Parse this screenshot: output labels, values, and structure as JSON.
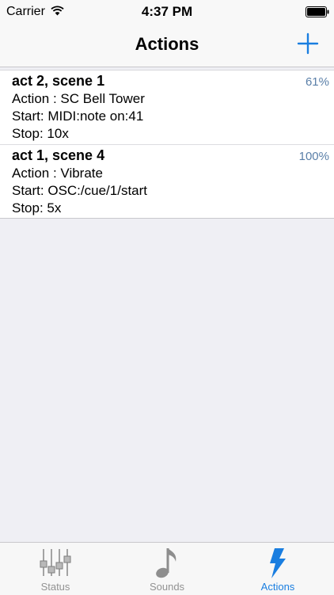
{
  "status_bar": {
    "carrier": "Carrier",
    "time": "4:37 PM"
  },
  "nav": {
    "title": "Actions",
    "add_icon": "plus-icon"
  },
  "actions": [
    {
      "title": "act 2, scene 1",
      "action": "Action : SC Bell Tower",
      "start": "Start: MIDI:note on:41",
      "stop": "Stop: 10x",
      "percent": "61%"
    },
    {
      "title": "act 1, scene 4",
      "action": "Action : Vibrate",
      "start": "Start: OSC:/cue/1/start",
      "stop": "Stop: 5x",
      "percent": "100%"
    }
  ],
  "tabs": [
    {
      "label": "Status",
      "icon": "mixer-sliders-icon",
      "active": false
    },
    {
      "label": "Sounds",
      "icon": "music-note-icon",
      "active": false
    },
    {
      "label": "Actions",
      "icon": "lightning-bolt-icon",
      "active": true
    }
  ],
  "colors": {
    "accent": "#1a7ee0",
    "percent": "#5a7fa8",
    "inactive_tab": "#929292",
    "background": "#efeff4"
  }
}
